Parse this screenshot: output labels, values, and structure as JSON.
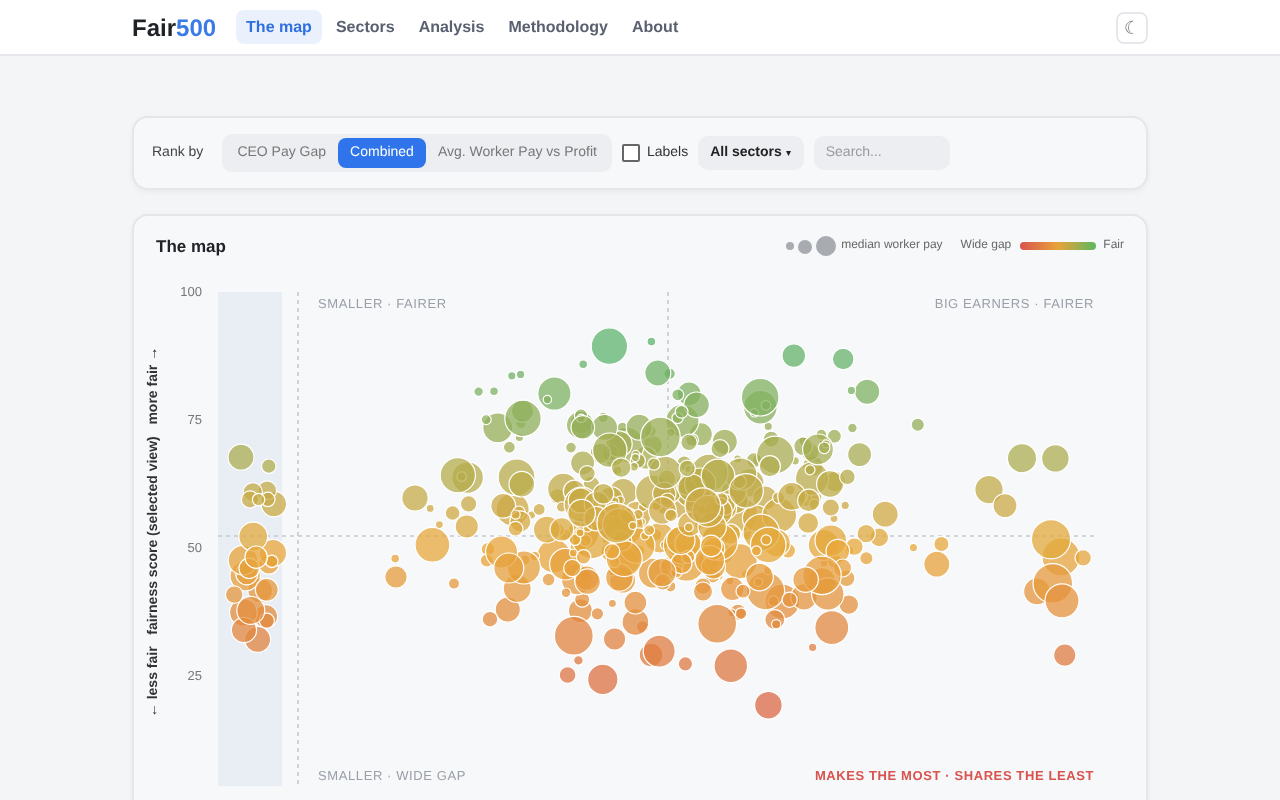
{
  "header": {
    "logo": {
      "text": "Fair",
      "accent": "500"
    },
    "nav": [
      {
        "label": "The map",
        "selected": true
      },
      {
        "label": "Sectors",
        "selected": false
      },
      {
        "label": "Analysis",
        "selected": false
      },
      {
        "label": "Methodology",
        "selected": false
      },
      {
        "label": "About",
        "selected": false
      }
    ],
    "theme_toggle": "☾"
  },
  "controls": {
    "rank_label": "Rank by",
    "rank_options": [
      {
        "label": "CEO Pay Gap",
        "selected": false
      },
      {
        "label": "Combined",
        "selected": true
      },
      {
        "label": "Avg. Worker Pay vs Profit",
        "selected": false
      }
    ],
    "labels_toggle": {
      "label": "Labels",
      "checked": false
    },
    "sector_select": {
      "value": "All sectors",
      "caret": "▾"
    },
    "search": {
      "placeholder": "Search..."
    }
  },
  "map": {
    "title": "The map",
    "legend": {
      "size_label": "median worker pay",
      "color_low": "Wide gap",
      "color_high": "Fair"
    },
    "y_axis_label": "← less fair   fairness score (selected view)   more fair →",
    "y_ticks": [
      "100",
      "75",
      "50",
      "25"
    ],
    "quadrants": [
      {
        "label": "SMALLER · FAIRER",
        "color": "#9aa0a8"
      },
      {
        "label": "BIG EARNERS · FAIRER",
        "color": "#9aa0a8"
      },
      {
        "label": "SMALLER · WIDE GAP",
        "color": "#9aa0a8"
      },
      {
        "label": "MAKES THE MOST · SHARES THE LEAST",
        "color": "#d9534f"
      }
    ]
  }
}
